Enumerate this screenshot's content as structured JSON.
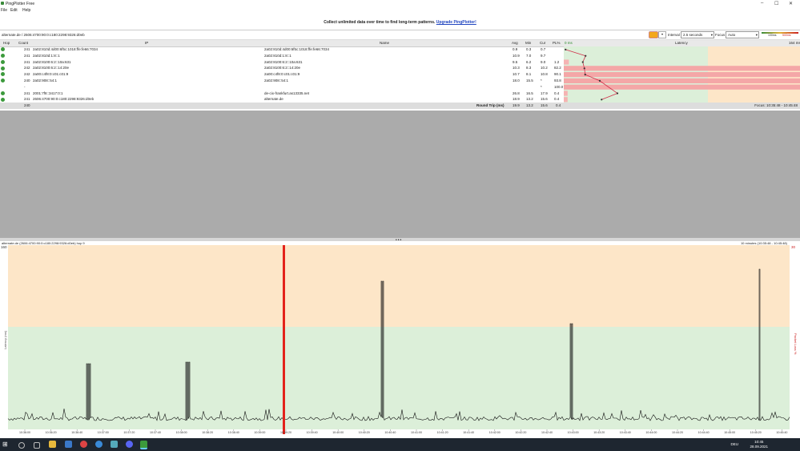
{
  "window": {
    "title": "PingPlotter Free",
    "min": "–",
    "max": "☐",
    "close": "✕"
  },
  "menu": [
    "File",
    "Edit",
    "Help"
  ],
  "banner": {
    "message": "Collect unlimited data over time to find long-term patterns.",
    "link": "Upgrade PingPlotter!"
  },
  "target": {
    "label": "alternate.de / 2606:4700:90:0:c180:2298:9326:d0eb",
    "interval_label": "Interval",
    "interval_value": "2.5 seconds",
    "focus_label": "Focus",
    "focus_value": "Auto",
    "scale_100": "100ms",
    "scale_500": "500ms",
    "status_color": "#f3a81b"
  },
  "table": {
    "headers": {
      "hop": "Hop",
      "count": "Count",
      "ip": "IP",
      "name": "Name",
      "avg": "Avg",
      "min": "Min",
      "cur": "Cur",
      "pl": "PL%",
      "ms": "0 ms",
      "latency": "Latency",
      "ms_right": "164 ms"
    },
    "rows": [
      {
        "hop": "1",
        "count": "241",
        "ip": "2a02:810d:4d00:6f5c:1018:ffe:fe66:7034",
        "name": "2a02:810d:4d00:6f5c:1018:ffe:fe66:7034",
        "avg": "0.9",
        "min": "0.3",
        "cur": "0.7",
        "pl": ""
      },
      {
        "hop": "2",
        "count": "241",
        "ip": "2a02:810d:1:8::1",
        "name": "2a02:810d:1:8::1",
        "avg": "10.9",
        "min": "7.0",
        "cur": "9.7",
        "pl": ""
      },
      {
        "hop": "3",
        "count": "241",
        "ip": "2a02:8100:6:2::10a:631",
        "name": "2a02:8100:6:2::10a:631",
        "avg": "9.5",
        "min": "6.2",
        "cur": "9.0",
        "pl": "1.2"
      },
      {
        "hop": "4",
        "count": "242",
        "ip": "2a02:8100:6:2::14:20e",
        "name": "2a02:8100:6:2::14:20e",
        "avg": "10.3",
        "min": "8.3",
        "cur": "10.2",
        "pl": "82.2"
      },
      {
        "hop": "5",
        "count": "242",
        "ip": "2a00:c4f8:0:c01:c01:9",
        "name": "2a00:c4f8:0:c01:c01:9",
        "avg": "10.7",
        "min": "8.1",
        "cur": "10.8",
        "pl": "90.1"
      },
      {
        "hop": "6",
        "count": "240",
        "ip": "2a02:908::54:1",
        "name": "2a02:908::54:1",
        "avg": "18.0",
        "min": "15.5",
        "cur": "*",
        "pl": "93.8"
      },
      {
        "hop": "7",
        "count": "-",
        "ip": "",
        "name": "",
        "avg": "",
        "min": "",
        "cur": "*",
        "pl": "100.0"
      },
      {
        "hop": "8",
        "count": "241",
        "ip": "2001:7f8::3417:0:1",
        "name": "de-cix-frankfurt.as13335.net",
        "avg": "26.8",
        "min": "16.5",
        "cur": "17.9",
        "pl": "0.4"
      },
      {
        "hop": "9",
        "count": "241",
        "ip": "2606:4700:90:0:c180:2298:9326:d0eb",
        "name": "alternate.de",
        "avg": "18.9",
        "min": "13.2",
        "cur": "15.6",
        "pl": "0.4"
      }
    ],
    "total": {
      "count": "240",
      "label": "Round Trip (ms)",
      "avg": "19.9",
      "min": "13.2",
      "cur": "15.6",
      "pl": "0.4",
      "focus": "Focus: 10:35:48 - 10:45:48"
    }
  },
  "graph": {
    "header_left": "alternate.de (2606:4700:90:0:c180:2298:9326:d0eb) hop 9",
    "header_right": "10 minutes (10:35:48 - 10:45:48)",
    "y_top": "160",
    "y_right": "30",
    "ylabel_left": "Latency (ms)",
    "ylabel_right": "Packet Loss %",
    "xticks": [
      "10:36:00",
      "10:36:20",
      "10:36:40",
      "10:37:00",
      "10:37:20",
      "10:37:40",
      "10:38:00",
      "10:38:20",
      "10:38:40",
      "10:39:00",
      "10:39:20",
      "10:39:40",
      "10:40:00",
      "10:40:20",
      "10:40:40",
      "10:41:00",
      "10:41:20",
      "10:41:40",
      "10:42:00",
      "10:42:20",
      "10:42:40",
      "10:43:00",
      "10:43:20",
      "10:43:40",
      "10:44:00",
      "10:44:20",
      "10:44:40",
      "10:45:00",
      "10:45:20",
      "10:45:40"
    ]
  },
  "taskbar": {
    "lang": "DEU",
    "time": "10:45",
    "date": "28.09.2021"
  }
}
